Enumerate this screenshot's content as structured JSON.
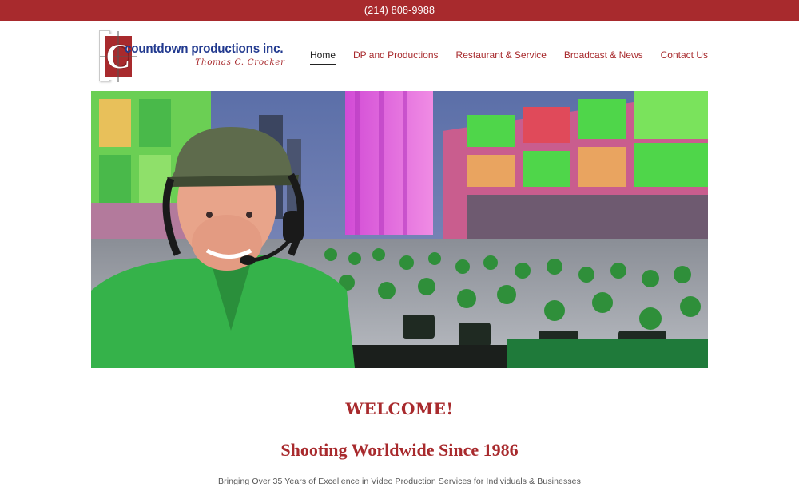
{
  "topbar": {
    "phone": "(214) 808-9988"
  },
  "brand": {
    "name": "countdown productions inc.",
    "owner": "Thomas C. Crocker",
    "logo_letter": "C",
    "colors": {
      "brand_red": "#a82a2d",
      "brand_blue": "#223a8f"
    }
  },
  "nav": {
    "items": [
      {
        "label": "Home",
        "active": true
      },
      {
        "label": "DP and Productions",
        "active": false
      },
      {
        "label": "Restaurant & Service",
        "active": false
      },
      {
        "label": "Broadcast & News",
        "active": false
      },
      {
        "label": "Contact Us",
        "active": false
      }
    ]
  },
  "hero": {
    "icon": "hero-photo"
  },
  "main": {
    "welcome": "WELCOME!",
    "tagline": "Shooting Worldwide Since 1986",
    "subline": "Bringing Over 35 Years of Excellence in Video Production Services for Individuals & Businesses"
  }
}
